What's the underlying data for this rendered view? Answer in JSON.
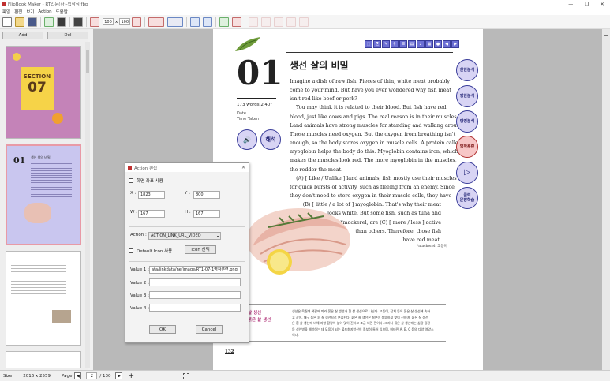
{
  "window": {
    "title": "FlipBook Maker - RT입문(하)-입학식.fbp",
    "minimize": "—",
    "maximize": "❐",
    "close": "✕"
  },
  "menu": [
    "파일",
    "편집",
    "보기",
    "Action",
    "도움말"
  ],
  "toolbar": {
    "width_value": "100",
    "x_label": "x",
    "height_value": "100"
  },
  "left_panel": {
    "add_label": "Add",
    "del_label": "Del",
    "section_label": "SECTION",
    "section_number": "07",
    "page2_number": "01",
    "page2_title": "생선 살의 비밀"
  },
  "page": {
    "title": "생선 살의 비밀",
    "number": "01",
    "words": "173 words",
    "time": "2'40\"",
    "date_label": "Date",
    "time_taken_label": "Time Taken",
    "listen_label": "🔊",
    "explain_label": "해석",
    "body": [
      "Imagine a dish of raw fish. Pieces of thin, white meat probably",
      "come to your mind. But have you ever wondered why fish meat",
      "isn't red like beef or pork?",
      "    You may think it is related to their blood. But fish have red",
      "blood, just like cows and pigs. The real reason is in their muscles.",
      "Land animals have strong muscles for standing and walking around.",
      "Those muscles need oxygen. But the oxygen from breathing isn't",
      "enough, so the body stores oxygen in muscle cells. A protein called",
      "myoglobin helps the body do this. Myoglobin contains iron, which",
      "makes the muscles look red. The more myoglobin in the muscles,",
      "the redder the meat.",
      "    (A) [ Like / Unlike ] land animals, fish mostly use their muscles",
      "for quick bursts of activity, such as fleeing from an enemy. Since",
      "they don't need to store oxygen in their muscle cells, they have",
      "(B) [ little / a lot of ] myoglobin. That's why their meat",
      "looks white. But some fish, such as tuna and",
      "*mackerel, are (C) [ more / less ] active",
      "than others. Therefore, those fish",
      "have red meat."
    ],
    "footnote": "*mackerel: 고등어",
    "korean_label_1": "살 생선",
    "korean_label_2": "붉은 살 생선",
    "korean_body": [
      "생선은 육질에 색깔에 따라 붉은 살 생선과 흰 살 생선으로 나뉜다. 고등어, 참치 등의 붉은 살 생선에 속하",
      "고 광어, 대구 등은 흰 살 생선으로 분류된다. 붉은 살 생선은 철분이 풍부하고 맛이 진하며, 붉은 살 생선",
      "은 흰 살 생선에 비해 지방 함량이 높아 맛이 진하고 조금 비린 편이다. 그러나 붉은 살 생선에는 심장 질환",
      "등 성인병을 예방하는 데 도움이 되는 불포화지방산이 풍부히 들어 있으며, 비타민 A, B, C 등의 다양 영양소",
      "이다."
    ],
    "page_no": "132",
    "side_buttons": [
      "한한분석",
      "영한분석",
      "영영분석",
      "영작훈련",
      "▷",
      "클릭\n문장학습"
    ]
  },
  "dialog": {
    "title": "Action 편집",
    "close": "✕",
    "fullscreen_label": "화면 좌표 사용",
    "x_label": "X :",
    "x_value": "1823",
    "y_label": "Y :",
    "y_value": "800",
    "w_label": "W :",
    "w_value": "167",
    "h_label": "H :",
    "h_value": "167",
    "action_label": "Action :",
    "action_value": "ACTION_LINK_URL_VIDEO",
    "default_icon_label": "Default Icon 사용",
    "icon_select_label": "Icon 선택",
    "value1_label": "Value 1 :",
    "value1": "ata/linkdata/ne/image/RT1-07-1영작훈련.png",
    "value2_label": "Value 2 :",
    "value3_label": "Value 3 :",
    "value4_label": "Value 4 :",
    "ok_label": "OK",
    "cancel_label": "Cancel"
  },
  "status": {
    "size_label": "Size",
    "size_value": "2016  x  2559",
    "page_label": "Page",
    "prev": "◀",
    "page_value": "2",
    "page_total": "/   130",
    "next": "▶",
    "add": "+"
  }
}
